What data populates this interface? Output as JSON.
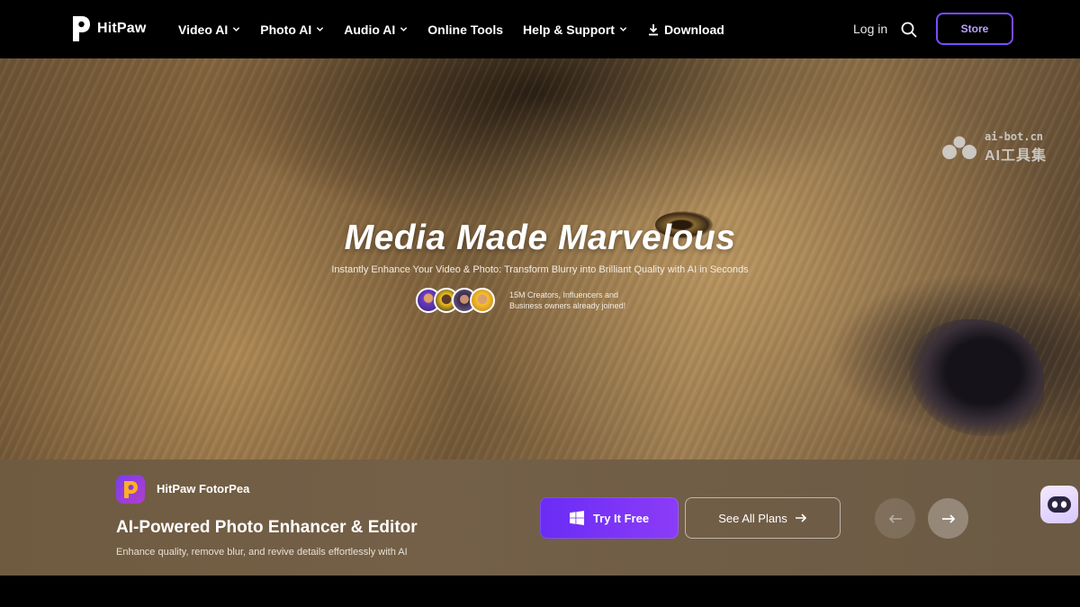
{
  "nav": {
    "logo_text": "HitPaw",
    "items": [
      {
        "label": "Video AI",
        "dropdown": true
      },
      {
        "label": "Photo AI",
        "dropdown": true
      },
      {
        "label": "Audio AI",
        "dropdown": true
      },
      {
        "label": "Online Tools",
        "dropdown": false
      },
      {
        "label": "Help & Support",
        "dropdown": true
      },
      {
        "label": "Download",
        "icon": "download-icon"
      }
    ],
    "login_label": "Log in",
    "store_label": "Store",
    "accent_color": "#7b4cff"
  },
  "hero": {
    "title": "Media Made Marvelous",
    "subtitle": "Instantly Enhance Your Video & Photo: Transform Blurry into Brilliant Quality with AI in Seconds",
    "creators_line1": "15M Creators, Influencers and",
    "creators_line2": "Business owners already joined!",
    "avatars": [
      "avatar-1",
      "avatar-2",
      "avatar-3",
      "avatar-4"
    ]
  },
  "watermark": {
    "line1": "ai-bot.cn",
    "line2": "AI工具集"
  },
  "product": {
    "name": "HitPaw FotorPea",
    "title": "AI-Powered Photo Enhancer & Editor",
    "description": "Enhance quality, remove blur, and revive details effortlessly with AI",
    "try_label": "Try It Free",
    "plans_label": "See All Plans"
  }
}
